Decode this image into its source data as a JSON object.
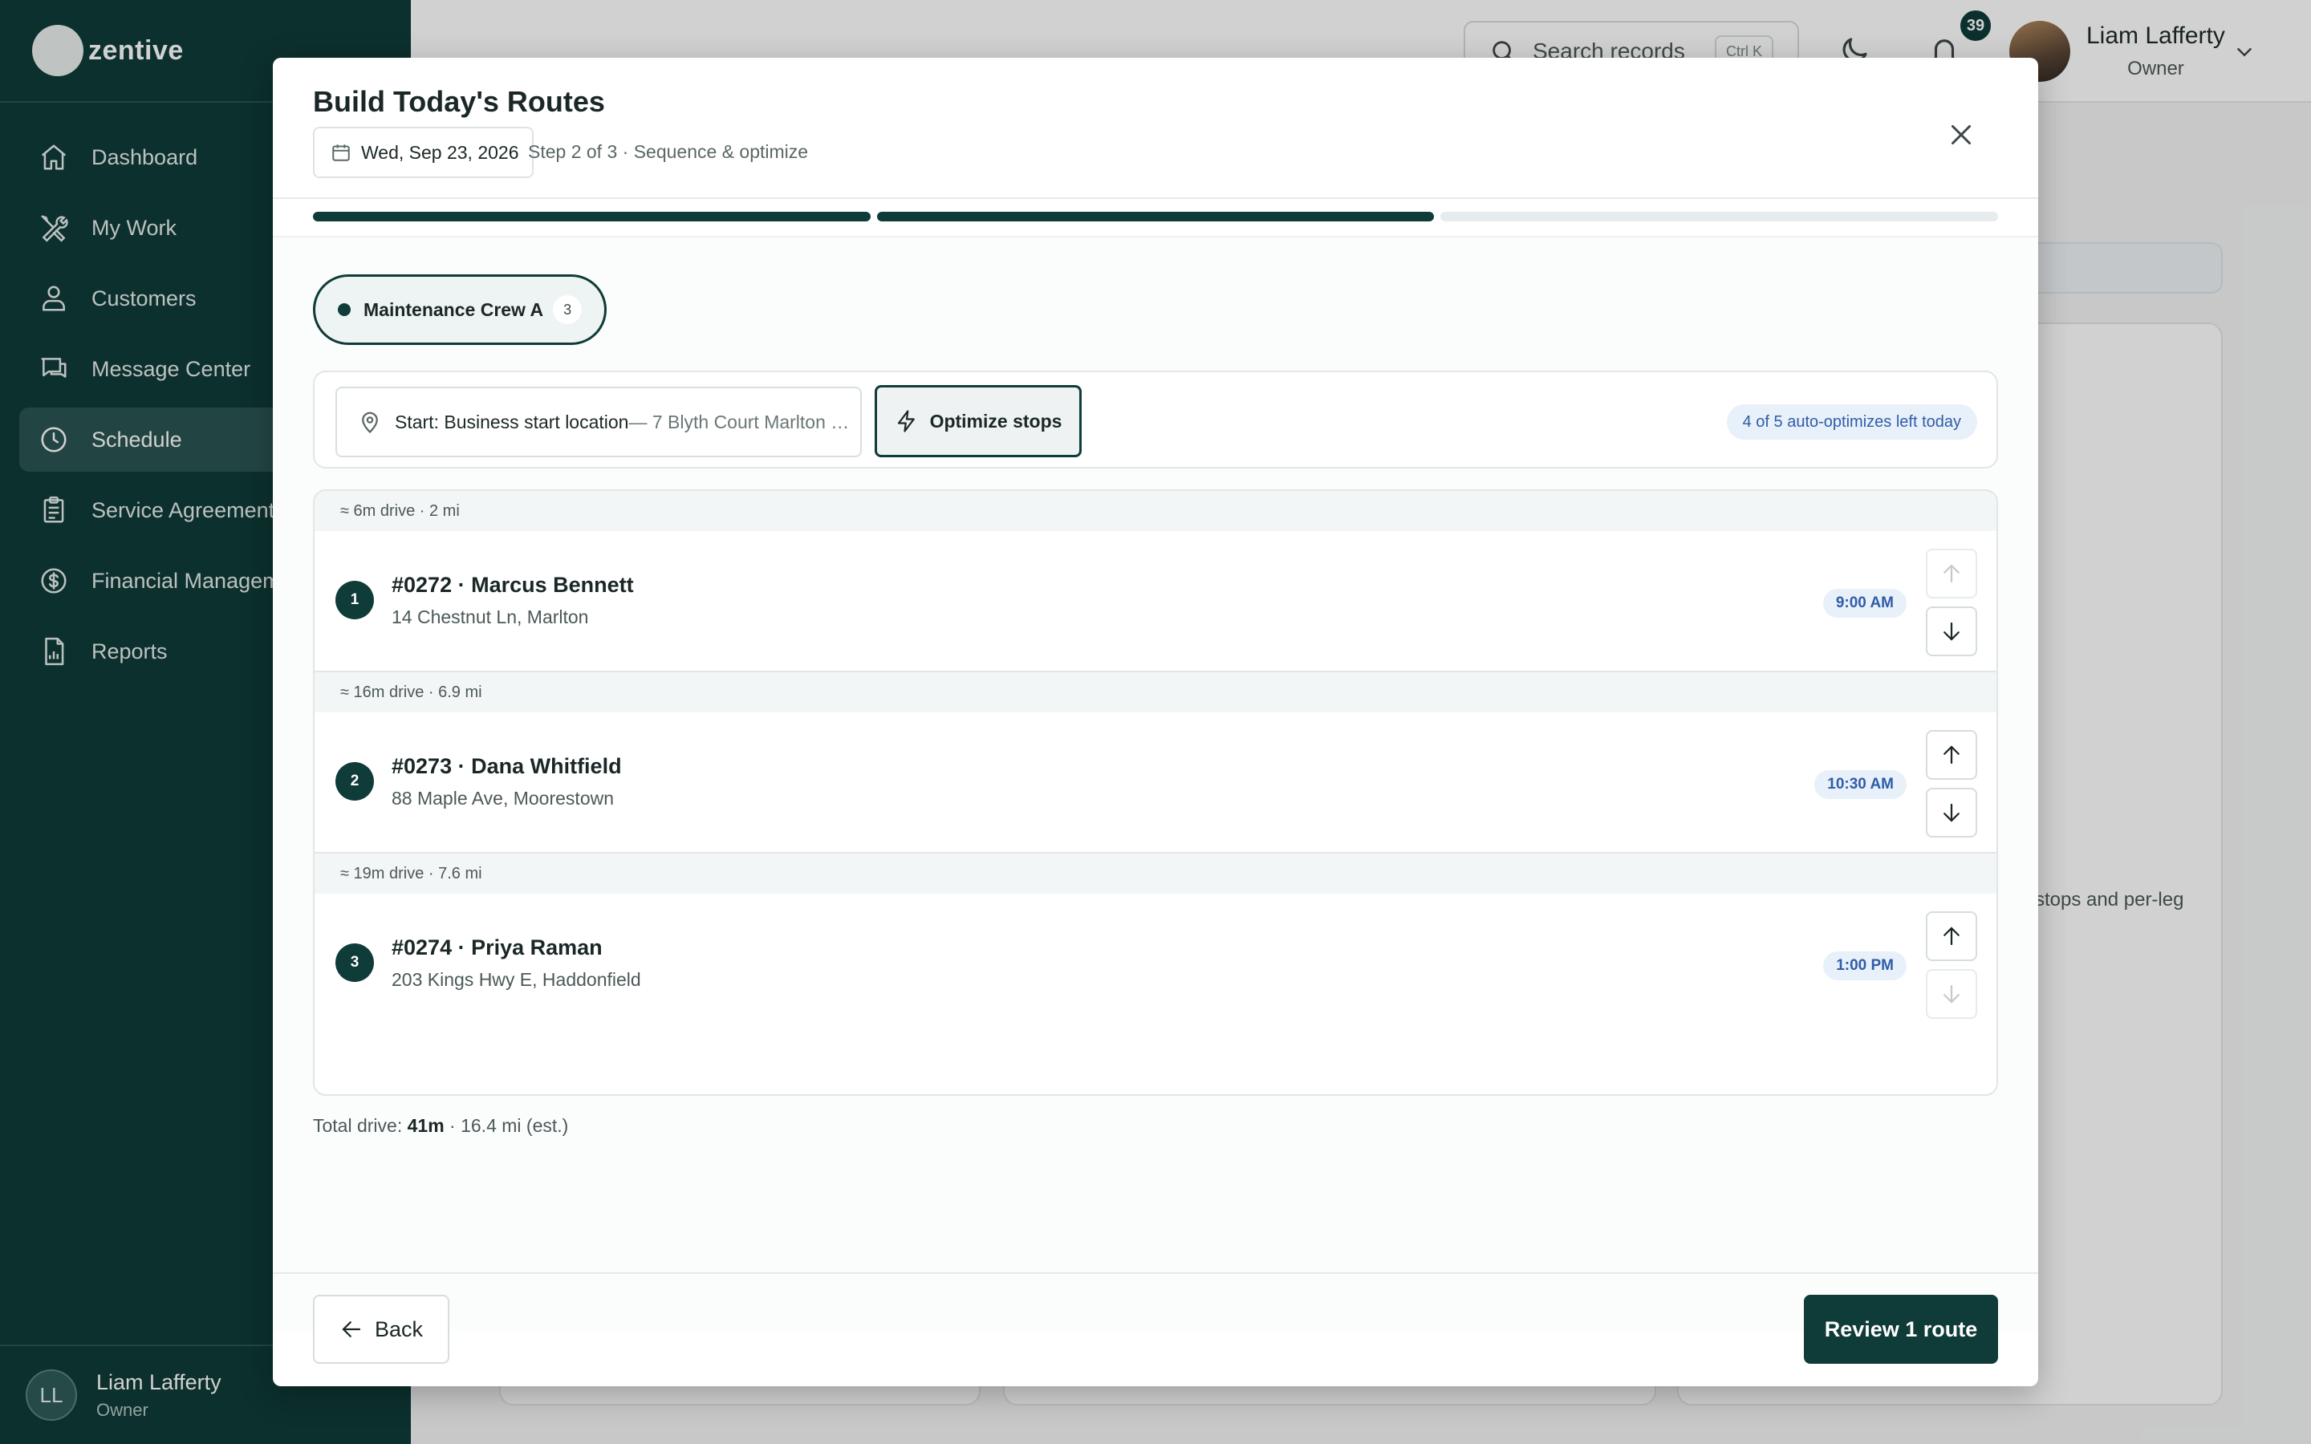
{
  "brand": {
    "name": "zentive"
  },
  "sidebar": {
    "items": [
      {
        "label": "Dashboard",
        "icon": "home-icon",
        "active": false
      },
      {
        "label": "My Work",
        "icon": "tools-icon",
        "active": false
      },
      {
        "label": "Customers",
        "icon": "users-icon",
        "active": false
      },
      {
        "label": "Message Center",
        "icon": "chat-icon",
        "active": false
      },
      {
        "label": "Schedule",
        "icon": "clock-icon",
        "active": true
      },
      {
        "label": "Service Agreements",
        "icon": "clipboard-icon",
        "active": false
      },
      {
        "label": "Financial Management",
        "icon": "dollar-icon",
        "active": false
      },
      {
        "label": "Reports",
        "icon": "report-icon",
        "active": false
      }
    ],
    "user": {
      "initials": "LL",
      "name": "Liam Lafferty",
      "role": "Owner"
    }
  },
  "header": {
    "search": {
      "placeholder": "Search records",
      "shortcut": "Ctrl K"
    },
    "notifications_count": "39",
    "user": {
      "name": "Liam Lafferty",
      "role": "Owner"
    }
  },
  "background": {
    "partial_text": "stops and per-leg"
  },
  "modal": {
    "title": "Build Today's Routes",
    "date": "Wed, Sep 23, 2026",
    "step_text": "Step 2 of 3 · Sequence & optimize",
    "progress": {
      "current_step": 2,
      "total_steps": 3
    },
    "crew": {
      "name": "Maintenance Crew A",
      "count": "3"
    },
    "start": {
      "label": "Start: Business start location",
      "address": " — 7 Blyth Court Marlton …"
    },
    "optimize_label": "Optimize stops",
    "auto_optimizes": "4 of 5 auto-optimizes left today",
    "stops": [
      {
        "leg": "≈ 6m drive · 2 mi",
        "number": "1",
        "title": "#0272 · Marcus Bennett",
        "address": "14 Chestnut Ln, Marlton",
        "time": "9:00 AM",
        "up_enabled": false,
        "down_enabled": true
      },
      {
        "leg": "≈ 16m drive · 6.9 mi",
        "number": "2",
        "title": "#0273 · Dana Whitfield",
        "address": "88 Maple Ave, Moorestown",
        "time": "10:30 AM",
        "up_enabled": true,
        "down_enabled": true
      },
      {
        "leg": "≈ 19m drive · 7.6 mi",
        "number": "3",
        "title": "#0274 · Priya Raman",
        "address": "203 Kings Hwy E, Haddonfield",
        "time": "1:00 PM",
        "up_enabled": true,
        "down_enabled": false
      }
    ],
    "total": {
      "label": "Total drive:",
      "time": "41m",
      "rest": " · 16.4 mi (est.)"
    },
    "back_label": "Back",
    "review_label": "Review 1 route"
  },
  "colors": {
    "brand": "#0f3b38",
    "accent_blue": "#2f5da8",
    "pill_blue_bg": "#e8f0fa"
  }
}
